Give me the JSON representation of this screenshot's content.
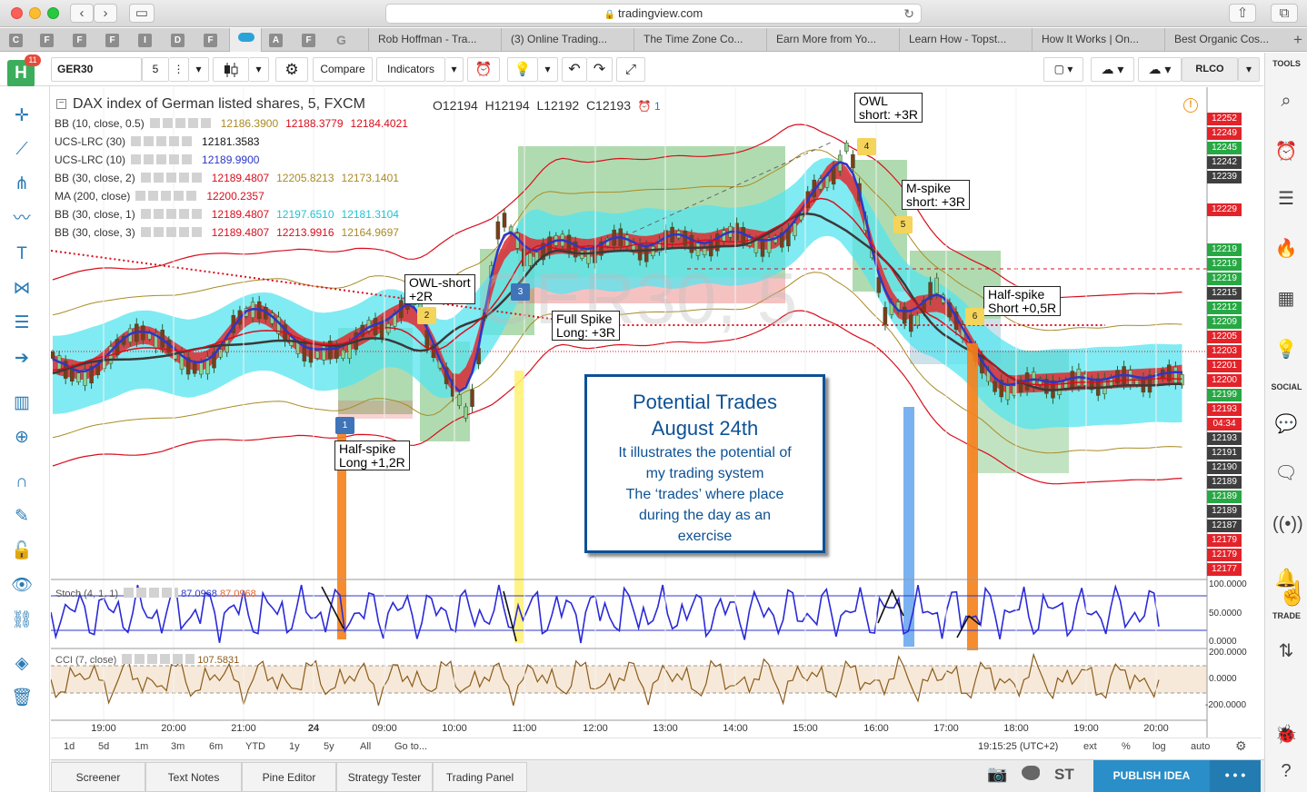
{
  "browser": {
    "url": "tradingview.com",
    "tabs": [
      "Rob Hoffman - Tra...",
      "(3) Online Trading...",
      "The Time Zone Co...",
      "Earn More from Yo...",
      "Learn How - Topst...",
      "How It Works | On...",
      "Best Organic Cos..."
    ],
    "favicons": [
      "C",
      "F",
      "F",
      "F",
      "I",
      "D",
      "F",
      "A",
      "F",
      "G"
    ]
  },
  "toolbar": {
    "avatar_letter": "H",
    "notifications": "11",
    "symbol": "GER30",
    "interval": "5",
    "compare": "Compare",
    "indicators": "Indicators",
    "account": "RLCO"
  },
  "rightbar": {
    "tools": "TOOLS",
    "social": "SOCIAL",
    "trade": "TRADE"
  },
  "legend": {
    "title": "DAX index of German listed shares, 5, FXCM",
    "open": "O12194",
    "high": "H12194",
    "low": "L12192",
    "close": "C12193",
    "alerts": "1",
    "rows": [
      {
        "label": "BB (10, close, 0.5)",
        "values": [
          "12186.3900",
          "12188.3779",
          "12184.4021"
        ],
        "colors": [
          "#a98b25",
          "#d80e1d",
          "#d80e1d"
        ]
      },
      {
        "label": "UCS-LRC (30)",
        "values": [
          "12181.3583"
        ],
        "colors": [
          "#111111"
        ]
      },
      {
        "label": "UCS-LRC (10)",
        "values": [
          "12189.9900"
        ],
        "colors": [
          "#2c36c8"
        ]
      },
      {
        "label": "BB (30, close, 2)",
        "values": [
          "12189.4807",
          "12205.8213",
          "12173.1401"
        ],
        "colors": [
          "#d80e1d",
          "#a98b25",
          "#a98b25"
        ]
      },
      {
        "label": "MA (200, close)",
        "values": [
          "12200.2357"
        ],
        "colors": [
          "#d80e1d"
        ]
      },
      {
        "label": "BB (30, close, 1)",
        "values": [
          "12189.4807",
          "12197.6510",
          "12181.3104"
        ],
        "colors": [
          "#d80e1d",
          "#1ec3d6",
          "#1ec3d6"
        ]
      },
      {
        "label": "BB (30, close, 3)",
        "values": [
          "12189.4807",
          "12213.9916",
          "12164.9697"
        ],
        "colors": [
          "#d80e1d",
          "#d80e1d",
          "#a98b25"
        ]
      }
    ]
  },
  "price_labels": [
    {
      "text": "12252",
      "bg": "#e3232a"
    },
    {
      "text": "12249",
      "bg": "#e3232a"
    },
    {
      "text": "12245",
      "bg": "#27a844"
    },
    {
      "text": "12242",
      "bg": "#3f3f3f"
    },
    {
      "text": "12239",
      "bg": "#3f3f3f"
    },
    {
      "text": "12229",
      "bg": "#e3232a"
    },
    {
      "text": "12219",
      "bg": "#27a844"
    },
    {
      "text": "12219",
      "bg": "#27a844"
    },
    {
      "text": "12219",
      "bg": "#27a844"
    },
    {
      "text": "12215",
      "bg": "#3f3f3f"
    },
    {
      "text": "12212",
      "bg": "#27a844"
    },
    {
      "text": "12209",
      "bg": "#27a844"
    },
    {
      "text": "12205",
      "bg": "#e3232a"
    },
    {
      "text": "12203",
      "bg": "#e3232a"
    },
    {
      "text": "12201",
      "bg": "#e3232a"
    },
    {
      "text": "12200",
      "bg": "#e3232a"
    },
    {
      "text": "12199",
      "bg": "#27a844"
    },
    {
      "text": "12193",
      "bg": "#e3232a"
    },
    {
      "text": "04:34",
      "bg": "#e3232a"
    },
    {
      "text": "12193",
      "bg": "#3f3f3f"
    },
    {
      "text": "12191",
      "bg": "#3f3f3f"
    },
    {
      "text": "12190",
      "bg": "#3f3f3f"
    },
    {
      "text": "12189",
      "bg": "#3f3f3f"
    },
    {
      "text": "12189",
      "bg": "#27a844"
    },
    {
      "text": "12189",
      "bg": "#3f3f3f"
    },
    {
      "text": "12187",
      "bg": "#3f3f3f"
    },
    {
      "text": "12179",
      "bg": "#e3232a"
    },
    {
      "text": "12179",
      "bg": "#e3232a"
    },
    {
      "text": "12177",
      "bg": "#e3232a"
    }
  ],
  "stoch": {
    "label": "Stoch (4, 1, 1)",
    "v1": "87.0968",
    "v2": "87.0968",
    "scale": [
      "100.0000",
      "50.0000",
      "0.0000"
    ]
  },
  "cci": {
    "label": "CCI (7, close)",
    "value": "107.5831",
    "scale": [
      "200.0000",
      "0.0000",
      "-200.0000"
    ]
  },
  "time_labels": [
    "19:00",
    "20:00",
    "21:00",
    "24",
    "09:00",
    "10:00",
    "11:00",
    "12:00",
    "13:00",
    "14:00",
    "15:00",
    "16:00",
    "17:00",
    "18:00",
    "19:00",
    "20:00"
  ],
  "ranges": [
    "1d",
    "5d",
    "1m",
    "3m",
    "6m",
    "YTD",
    "1y",
    "5y",
    "All",
    "Go to..."
  ],
  "clock": "19:15:25 (UTC+2)",
  "toggles": [
    "ext",
    "%",
    "log",
    "auto"
  ],
  "bottom_tabs": [
    "Screener",
    "Text Notes",
    "Pine Editor",
    "Strategy Tester",
    "Trading Panel"
  ],
  "bottom_st": "ST",
  "publish": "PUBLISH IDEA",
  "annotations": [
    {
      "lines": [
        "Half-spike",
        "Long +1,2R"
      ]
    },
    {
      "lines": [
        "OWL-short",
        "+2R"
      ]
    },
    {
      "lines": [
        "Full Spike",
        "Long: +3R"
      ]
    },
    {
      "lines": [
        "OWL",
        "short: +3R"
      ]
    },
    {
      "lines": [
        "M-spike",
        "short: +3R"
      ]
    },
    {
      "lines": [
        "Half-spike",
        "Short +0,5R"
      ]
    }
  ],
  "markers": [
    "1",
    "2",
    "3",
    "4",
    "5",
    "6"
  ],
  "promo": {
    "title1": "Potential Trades",
    "title2": "August 24th",
    "body": [
      "It illustrates the potential of",
      "my trading system",
      "The ‘trades’ where place",
      "during the day as an",
      "exercise"
    ]
  }
}
